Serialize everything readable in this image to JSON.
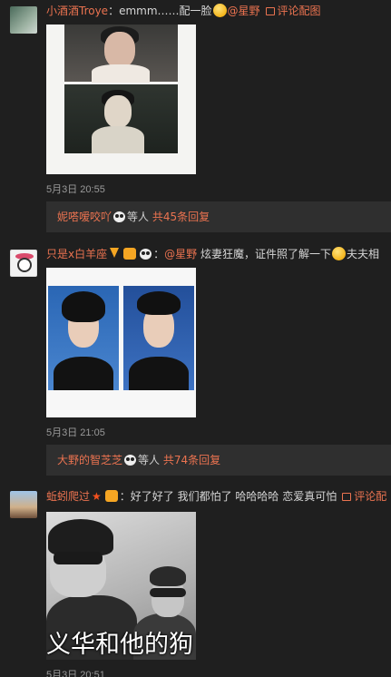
{
  "comments": [
    {
      "username": "小酒酒Troye",
      "text_prefix": "：emmm……配一脸",
      "mention": "@星野",
      "pic_link": "评论配图",
      "time": "5月3日 20:55",
      "reply": {
        "name": "妮嗒嗳咬吖",
        "middle": "等人",
        "count": "共45条回复"
      }
    },
    {
      "username": "只是x白羊座",
      "text_prefix": "：",
      "mention": "@星野",
      "text_suffix": "炫妻狂魔，证件照了解一下",
      "text_end": "夫夫相",
      "time": "5月3日 21:05",
      "reply": {
        "name": "大野的智芝芝",
        "middle": "等人",
        "count": "共74条回复"
      }
    },
    {
      "username": "蚯蚓爬过",
      "text": "：好了好了 我们都怕了 哈哈哈哈 恋爱真可怕",
      "pic_link": "评论配",
      "time": "5月3日 20:51",
      "photo_subtitle": "义华和他的狗"
    }
  ],
  "colors": {
    "background": "#1f1f1f",
    "accent": "#eb7350",
    "reply_bg": "#2f2f2f"
  },
  "icons": [
    "emoji-face-icon",
    "panda-icon",
    "verified-v-icon",
    "star-icon",
    "vip-badge-icon",
    "picture-icon"
  ]
}
